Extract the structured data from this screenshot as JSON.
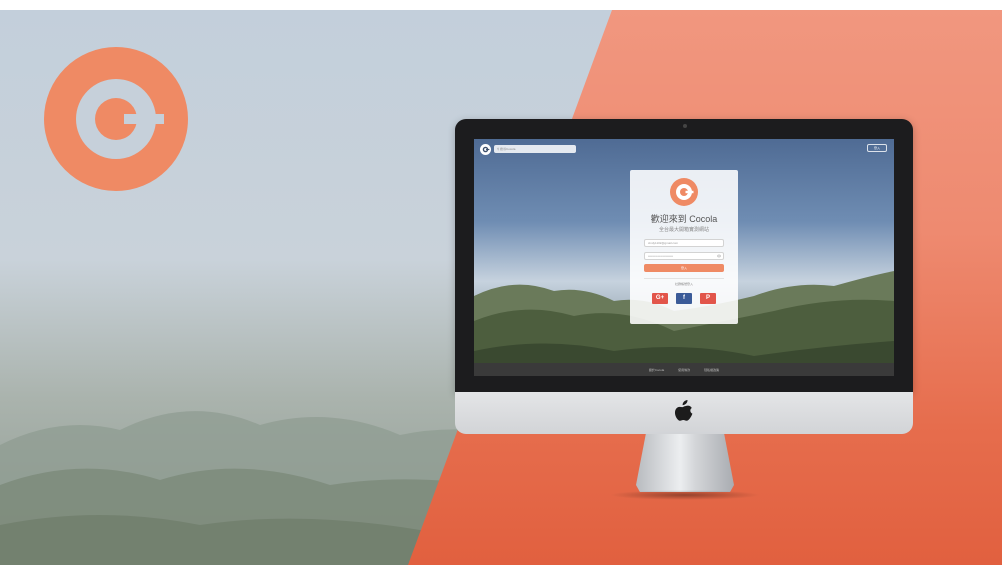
{
  "colors": {
    "brand_orange": "#ef8a64",
    "google_red": "#e2554a",
    "facebook_blue": "#3b5b98",
    "bezel": "#1c1c1e"
  },
  "screen": {
    "search": {
      "placeholder": "搜尋Cocola"
    },
    "header_login_label": "登入",
    "card": {
      "title": "歡迎來到 Cocola",
      "subtitle": "全台最大開箱實測網站",
      "email_value": "cindy1102@gmail.com",
      "password_value": "••••••••••••••••••••••••",
      "submit_label": "登入",
      "social_label": "社群帳號登入",
      "google_label": "G+",
      "facebook_label": "f",
      "pinterest_label": "P"
    },
    "footer": {
      "links": [
        "關於Cocola",
        "使用條款",
        "隱私權政策"
      ]
    }
  },
  "icons": {
    "logo": "cocola-c-logo-icon",
    "apple": "apple-logo-icon",
    "eye": "eye-icon",
    "search": "search-icon"
  }
}
